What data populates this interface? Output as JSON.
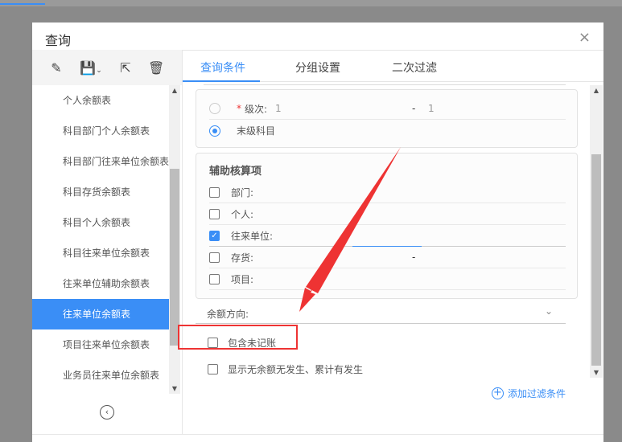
{
  "dialog": {
    "title": "查询",
    "close_icon": "×"
  },
  "toolbar": {
    "icons": [
      "edit-icon",
      "save-icon",
      "export-icon",
      "delete-icon"
    ]
  },
  "sidebar": {
    "items": [
      "个人余额表",
      "科目部门个人余额表",
      "科目部门往来单位余额表",
      "科目存货余额表",
      "科目个人余额表",
      "科目往来单位余额表",
      "往来单位辅助余额表",
      "往来单位余额表",
      "项目往来单位余额表",
      "业务员往来单位余额表"
    ],
    "selected": "往来单位余额表"
  },
  "tabs": [
    "查询条件",
    "分组设置",
    "二次过滤"
  ],
  "level": {
    "required_mark": "*",
    "label": "级次:",
    "from": "1",
    "sep": "-",
    "to": "1",
    "leaf_label": "末级科目"
  },
  "aux": {
    "title": "辅助核算项",
    "items": [
      {
        "label": "部门:",
        "checked": false
      },
      {
        "label": "个人:",
        "checked": false
      },
      {
        "label": "往来单位:",
        "checked": true
      },
      {
        "label": "存货:",
        "checked": false,
        "sep": "-"
      },
      {
        "label": "项目:",
        "checked": false
      }
    ]
  },
  "direction": {
    "label": "余额方向:"
  },
  "options": {
    "unposted": "包含未记账",
    "no_balance": "显示无余额无发生、累计有发生"
  },
  "add_filter": {
    "label": "添加过滤条件"
  },
  "colors": {
    "accent": "#3a8ef6",
    "annotation": "#ee3333"
  }
}
